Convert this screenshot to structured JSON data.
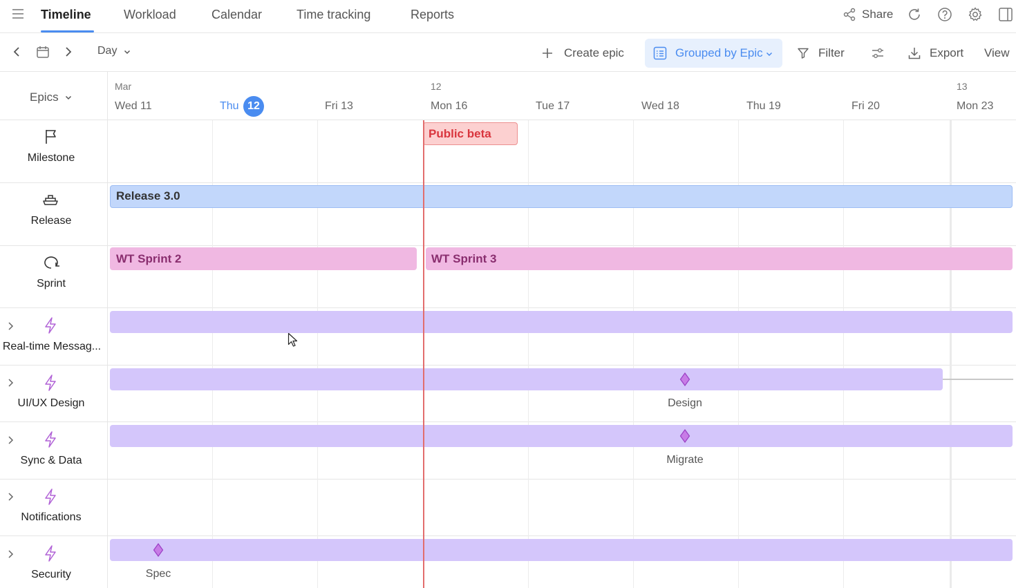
{
  "nav": {
    "tabs": [
      {
        "label": "Timeline"
      },
      {
        "label": "Workload"
      },
      {
        "label": "Calendar"
      },
      {
        "label": "Time tracking"
      },
      {
        "label": "Reports"
      }
    ],
    "share_label": "Share"
  },
  "toolbar": {
    "zoom_value": "Day",
    "create_epic_label": "Create epic",
    "grouped_label": "Grouped by Epic",
    "filter_label": "Filter",
    "export_label": "Export",
    "view_label": "View"
  },
  "left": {
    "epics_label": "Epics",
    "rows": [
      {
        "label": "Milestone"
      },
      {
        "label": "Release"
      },
      {
        "label": "Sprint"
      },
      {
        "label": "Real-time Messag..."
      },
      {
        "label": "UI/UX Design"
      },
      {
        "label": "Sync & Data"
      },
      {
        "label": "Notifications"
      },
      {
        "label": "Security"
      }
    ]
  },
  "timeline": {
    "month_labels": [
      {
        "text": "Mar"
      },
      {
        "text": "12"
      },
      {
        "text": "13"
      }
    ],
    "dates": [
      {
        "text": "Wed 11"
      },
      {
        "text": "Thu"
      },
      {
        "text": "Fri 13"
      },
      {
        "text": "Mon 16"
      },
      {
        "text": "Tue 17"
      },
      {
        "text": "Wed 18"
      },
      {
        "text": "Thu 19"
      },
      {
        "text": "Fri 20"
      },
      {
        "text": "Mon 23"
      }
    ],
    "today_badge": "12",
    "items": {
      "public_beta": "Public beta",
      "release": "Release 3.0",
      "sprint2": "WT Sprint 2",
      "sprint3": "WT Sprint 3",
      "design_ms": "Design",
      "migrate_ms": "Migrate",
      "spec_ms": "Spec"
    }
  },
  "colors": {
    "accent": "#4a8cf0",
    "today_line": "#e26d6d",
    "milestone_bg": "#fcd0d0",
    "release_bg": "#c2d7fb",
    "sprint_bg": "#f0b8e2",
    "epic_bg": "#d4c6fb",
    "epic_icon": "#b061d6"
  }
}
